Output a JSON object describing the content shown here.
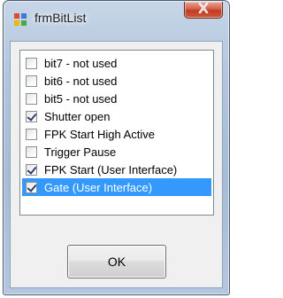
{
  "window": {
    "title": "frmBitList",
    "close_glyph": "X"
  },
  "list": {
    "items": [
      {
        "label": "bit7 - not used",
        "checked": false,
        "selected": false
      },
      {
        "label": "bit6 - not used",
        "checked": false,
        "selected": false
      },
      {
        "label": "bit5 - not used",
        "checked": false,
        "selected": false
      },
      {
        "label": "Shutter open",
        "checked": true,
        "selected": false
      },
      {
        "label": "FPK Start High Active",
        "checked": false,
        "selected": false
      },
      {
        "label": "Trigger Pause",
        "checked": false,
        "selected": false
      },
      {
        "label": "FPK Start (User Interface)",
        "checked": true,
        "selected": false
      },
      {
        "label": "Gate (User Interface)",
        "checked": true,
        "selected": true
      }
    ]
  },
  "buttons": {
    "ok_label": "OK"
  },
  "colors": {
    "selection": "#3399ff",
    "close_button": "#c13b22"
  },
  "icons": {
    "app": "form-icon",
    "close": "close-icon"
  }
}
